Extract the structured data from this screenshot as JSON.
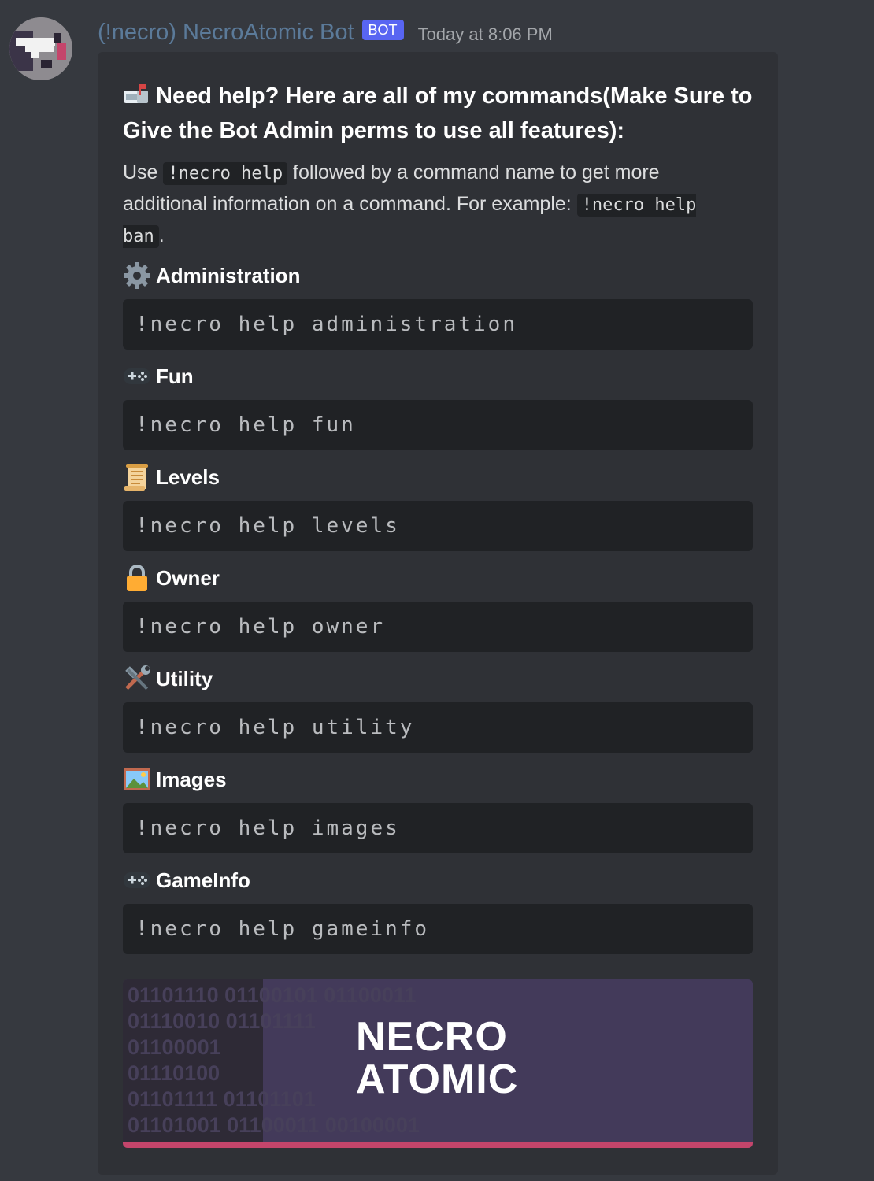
{
  "message": {
    "author": "(!necro) NecroAtomic Bot",
    "bot_tag": "BOT",
    "timestamp": "Today at 8:06 PM",
    "avatar_icon": "pixel-dragon-avatar"
  },
  "embed": {
    "title": "Need help? Here are all of my commands(Make Sure to Give the Bot Admin perms to use all features):",
    "title_icon": "mailbox-icon",
    "description": {
      "part1": "Use ",
      "code1": "!necro help",
      "part2": " followed by a command name to get more additional information on a command. For example: ",
      "code2": "!necro help ban",
      "part3": "."
    },
    "sections": [
      {
        "title": "Administration",
        "icon": "gear-icon",
        "command": "!necro help administration"
      },
      {
        "title": "Fun",
        "icon": "gamepad-icon",
        "command": "!necro help fun"
      },
      {
        "title": "Levels",
        "icon": "scroll-icon",
        "command": "!necro help levels"
      },
      {
        "title": "Owner",
        "icon": "lock-icon",
        "command": "!necro help owner"
      },
      {
        "title": "Utility",
        "icon": "hammer-wrench-icon",
        "command": "!necro help utility"
      },
      {
        "title": "Images",
        "icon": "framed-picture-icon",
        "command": "!necro help images"
      },
      {
        "title": "GameInfo",
        "icon": "gamepad-icon",
        "command": "!necro help gameinfo"
      }
    ],
    "image": {
      "logo_line1": "NECRO",
      "logo_line2": "ATOMIC",
      "binary": "01101110 01100101 01100011\n01110010 01101111\n01100001\n01110100\n01101111 01101101\n01101001 01100011 00100001",
      "accent": "#c4456b"
    }
  },
  "colors": {
    "background": "#36393f",
    "embed_background": "#2f3136",
    "code_background": "#202225",
    "username": "#5b7a99",
    "bot_tag": "#5865f2"
  }
}
